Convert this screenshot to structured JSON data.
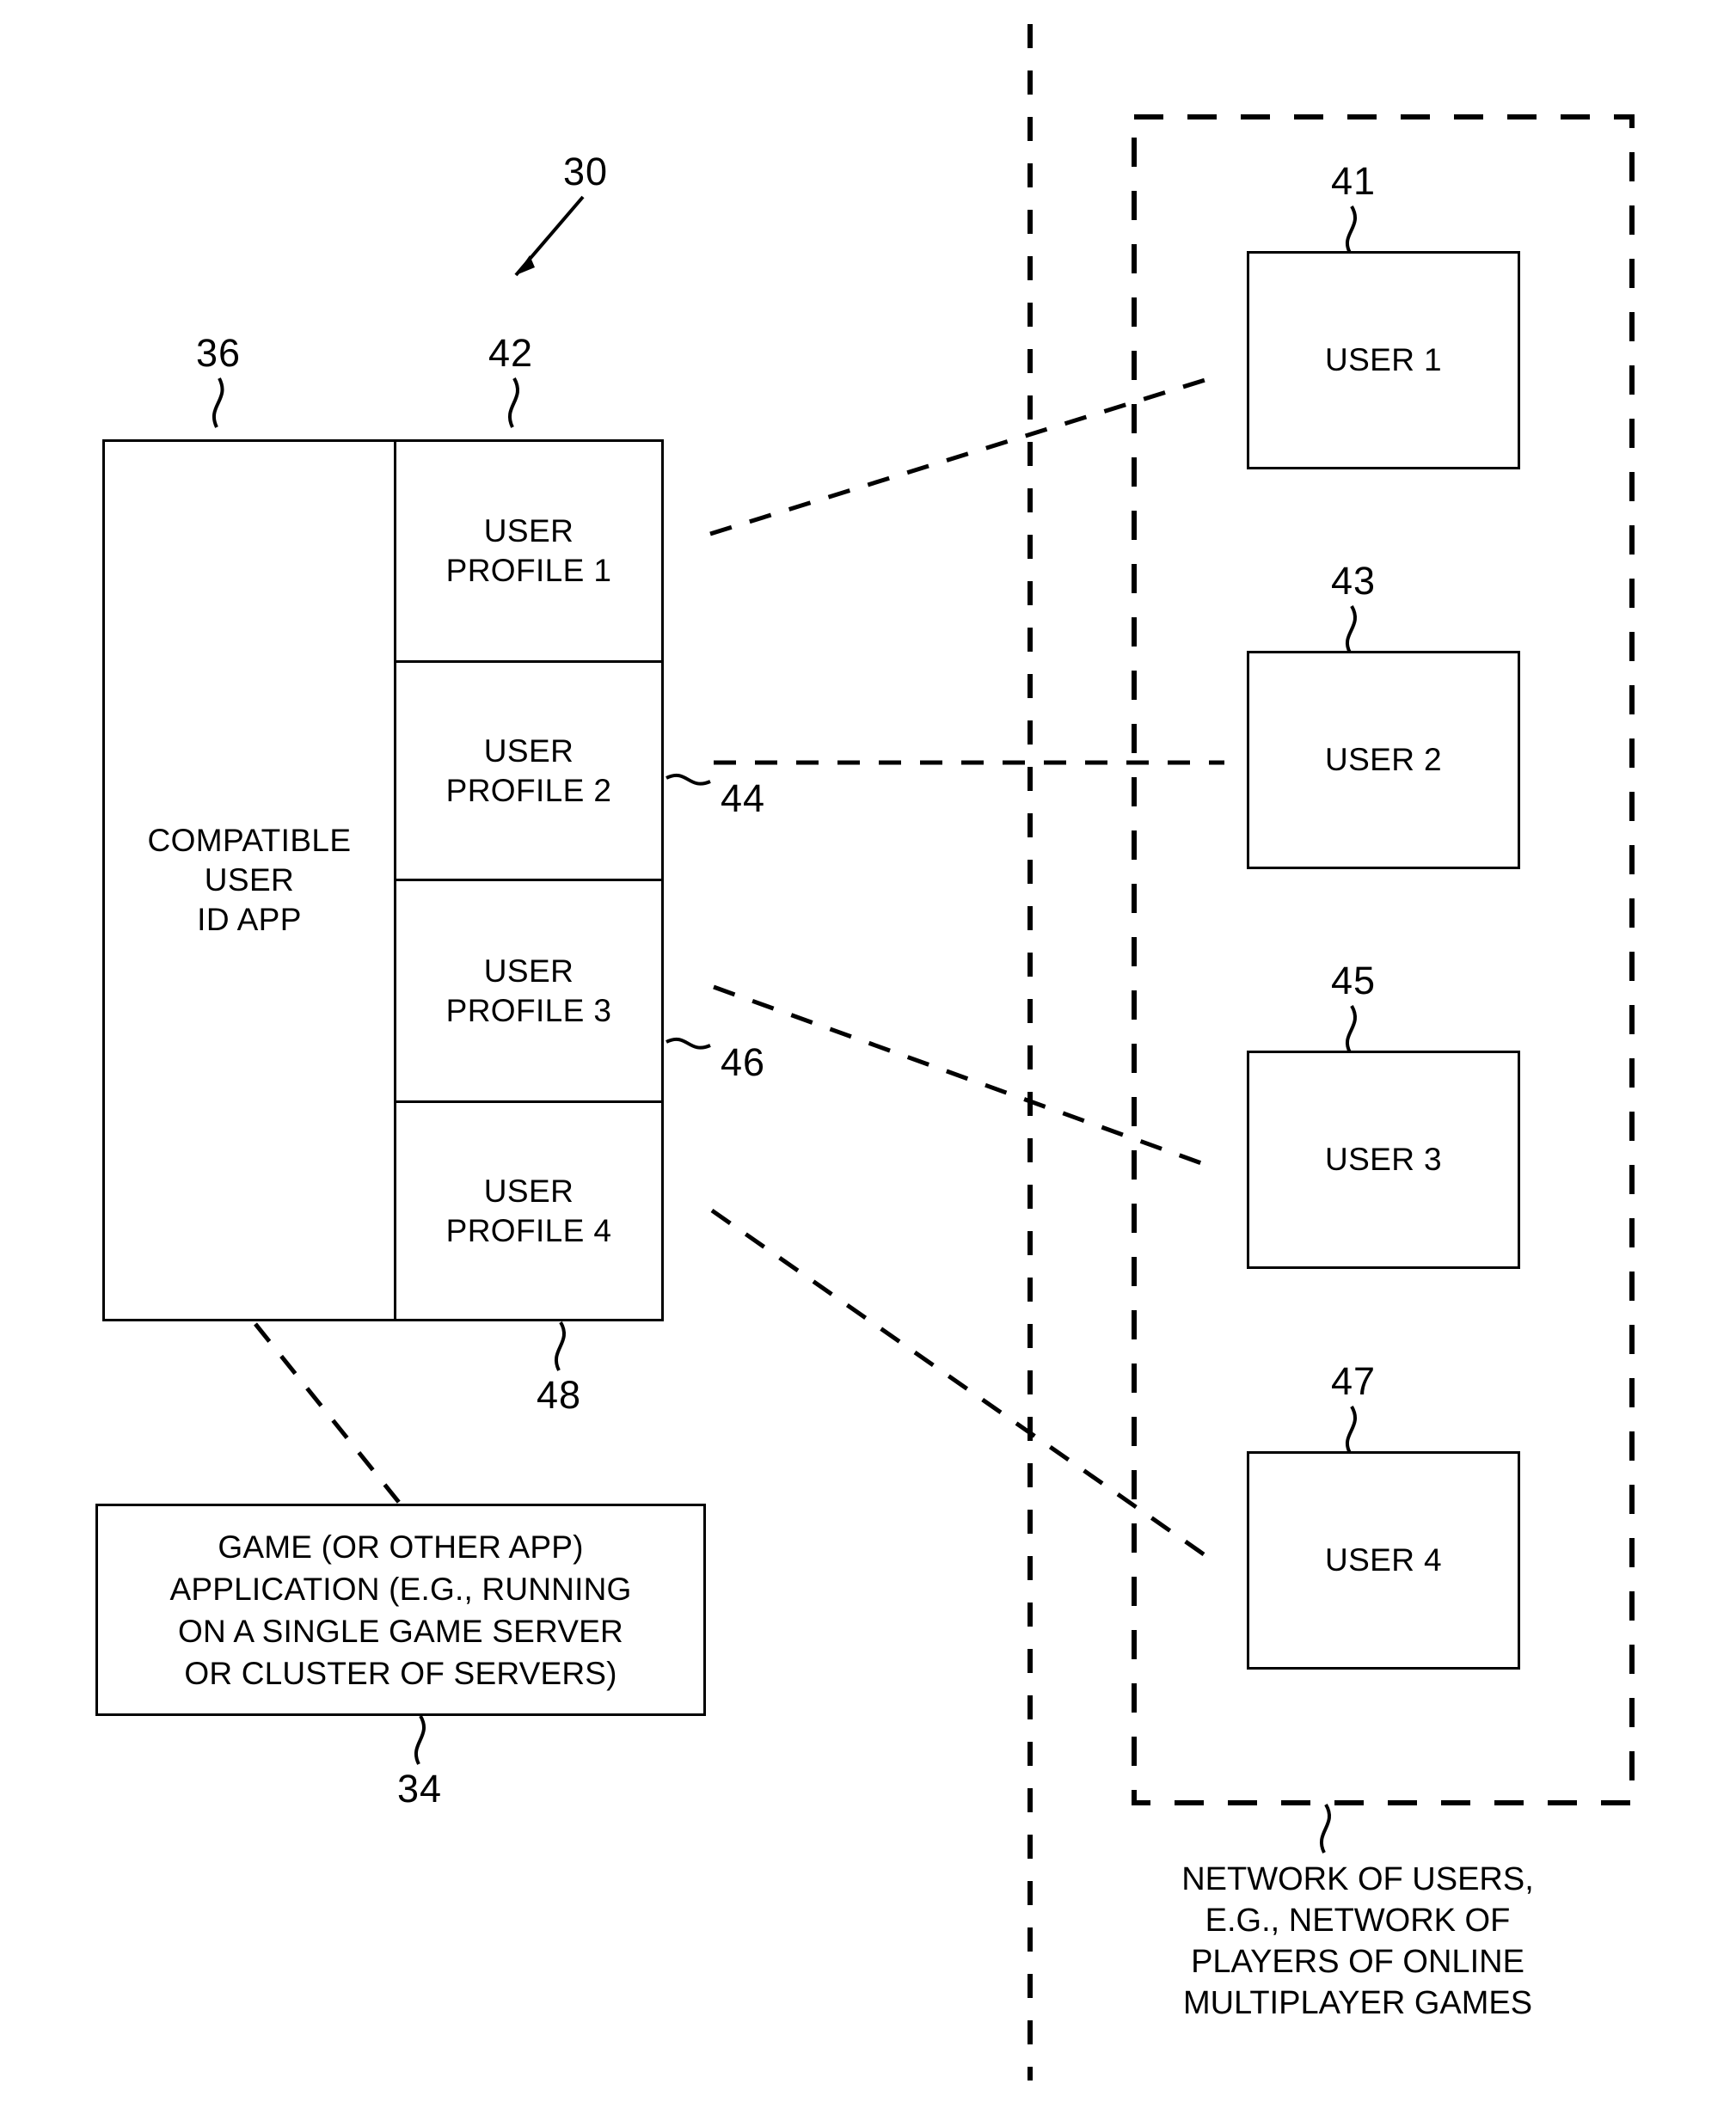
{
  "figure": {
    "figure_ref": "30"
  },
  "left_system": {
    "ref_app": "36",
    "ref_profiles_column": "42",
    "ref_profile2_callout": "44",
    "ref_profile3_callout": "46",
    "ref_profiles_bottom": "48",
    "app_label": "COMPATIBLE\nUSER\nID APP",
    "profiles": [
      {
        "label": "USER\nPROFILE 1"
      },
      {
        "label": "USER\nPROFILE 2"
      },
      {
        "label": "USER\nPROFILE 3"
      },
      {
        "label": "USER\nPROFILE 4"
      }
    ]
  },
  "game_application": {
    "ref": "34",
    "label": "GAME (OR OTHER APP)\nAPPLICATION (E.G., RUNNING\nON A SINGLE GAME SERVER\nOR CLUSTER OF SERVERS)"
  },
  "network": {
    "caption": "NETWORK OF USERS,\nE.G., NETWORK OF\nPLAYERS OF ONLINE\nMULTIPLAYER GAMES",
    "users": [
      {
        "label": "USER 1",
        "ref": "41"
      },
      {
        "label": "USER 2",
        "ref": "43"
      },
      {
        "label": "USER 3",
        "ref": "45"
      },
      {
        "label": "USER 4",
        "ref": "47"
      }
    ]
  },
  "colors": {
    "line": "#000000",
    "background": "#ffffff"
  }
}
